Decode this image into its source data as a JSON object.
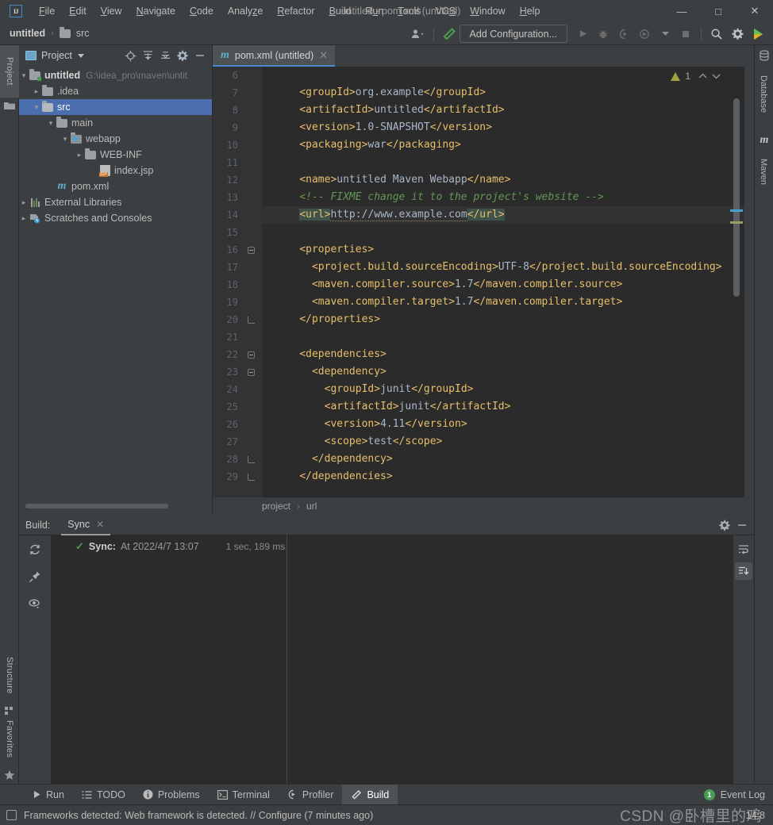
{
  "window": {
    "title": "untitled - pom.xml (untitled)",
    "logo_text": "IJ",
    "minimize": "—",
    "maximize": "□",
    "close": "✕"
  },
  "menu": {
    "items": [
      {
        "label": "File"
      },
      {
        "label": "Edit"
      },
      {
        "label": "View"
      },
      {
        "label": "Navigate"
      },
      {
        "label": "Code"
      },
      {
        "label": "Analyze"
      },
      {
        "label": "Refactor"
      },
      {
        "label": "Build"
      },
      {
        "label": "Run"
      },
      {
        "label": "Tools"
      },
      {
        "label": "VCS"
      },
      {
        "label": "Window"
      },
      {
        "label": "Help"
      }
    ]
  },
  "navbar": {
    "project_name": "untitled",
    "separator": "›",
    "current": "src",
    "add_configuration": "Add Configuration...",
    "icons": [
      "user-avatar-icon",
      "build-hammer-icon",
      "run-icon",
      "debug-icon",
      "run-coverage-icon",
      "profile-icon",
      "stop-icon",
      "search-everywhere-icon",
      "settings-gear-icon",
      "updates-icon"
    ]
  },
  "left_strip": {
    "project_label": "Project",
    "structure_label": "Structure",
    "favorites_label": "Favorites"
  },
  "right_strip": {
    "database_label": "Database",
    "maven_label": "Maven",
    "maven_glyph": "m"
  },
  "project_panel": {
    "title": "Project",
    "header_icons": [
      "locate-icon",
      "expand-all-icon",
      "collapse-all-icon",
      "settings-gear-icon",
      "hide-icon"
    ],
    "tree": [
      {
        "label": "untitled",
        "path": "G:\\idea_pro\\maven\\untit",
        "icon": "module-folder-icon",
        "indent": 0,
        "chevron": "v",
        "bold": true,
        "selected": false
      },
      {
        "label": ".idea",
        "path": "",
        "icon": "folder-icon",
        "indent": 1,
        "chevron": ">",
        "bold": false,
        "selected": false
      },
      {
        "label": "src",
        "path": "",
        "icon": "folder-icon",
        "indent": 1,
        "chevron": "v",
        "bold": false,
        "selected": true
      },
      {
        "label": "main",
        "path": "",
        "icon": "folder-icon",
        "indent": 2,
        "chevron": "v",
        "bold": false,
        "selected": false
      },
      {
        "label": "webapp",
        "path": "",
        "icon": "webapp-folder-icon",
        "indent": 3,
        "chevron": "v",
        "bold": false,
        "selected": false
      },
      {
        "label": "WEB-INF",
        "path": "",
        "icon": "folder-icon",
        "indent": 4,
        "chevron": ">",
        "bold": false,
        "selected": false
      },
      {
        "label": "index.jsp",
        "path": "",
        "icon": "jsp-file-icon",
        "indent": 5,
        "chevron": "",
        "bold": false,
        "selected": false
      },
      {
        "label": "pom.xml",
        "path": "",
        "icon": "maven-file-icon",
        "indent": 2,
        "chevron": "",
        "bold": false,
        "selected": false
      },
      {
        "label": "External Libraries",
        "path": "",
        "icon": "libraries-icon",
        "indent": 0,
        "chevron": ">",
        "bold": false,
        "selected": false
      },
      {
        "label": "Scratches and Consoles",
        "path": "",
        "icon": "scratches-icon",
        "indent": 0,
        "chevron": ">",
        "bold": false,
        "selected": false
      }
    ]
  },
  "editor": {
    "tab": {
      "label": "pom.xml (untitled)",
      "icon": "maven-file-icon",
      "close": "✕"
    },
    "warning_count": "1",
    "warning_icon": "warning-triangle-icon",
    "nav_up": "⌃",
    "nav_down": "⌄",
    "first_line_number": 6,
    "current_line": 14,
    "lines": [
      {
        "n": 6,
        "fold": "",
        "html": ""
      },
      {
        "n": 7,
        "fold": "",
        "html": "    <span class='tg'>&lt;groupId&gt;</span><span class='vl'>org.example</span><span class='tg'>&lt;/groupId&gt;</span>"
      },
      {
        "n": 8,
        "fold": "",
        "html": "    <span class='tg'>&lt;artifactId&gt;</span><span class='vl'>untitled</span><span class='tg'>&lt;/artifactId&gt;</span>"
      },
      {
        "n": 9,
        "fold": "",
        "html": "    <span class='tg'>&lt;version&gt;</span><span class='vl'>1.0-SNAPSHOT</span><span class='tg'>&lt;/version&gt;</span>"
      },
      {
        "n": 10,
        "fold": "",
        "html": "    <span class='tg'>&lt;packaging&gt;</span><span class='vl'>war</span><span class='tg'>&lt;/packaging&gt;</span>"
      },
      {
        "n": 11,
        "fold": "",
        "html": ""
      },
      {
        "n": 12,
        "fold": "",
        "html": "    <span class='tg'>&lt;name&gt;</span><span class='vl'>untitled Maven Webapp</span><span class='tg'>&lt;/name&gt;</span>"
      },
      {
        "n": 13,
        "fold": "",
        "html": "    <span class='cm'>&lt;!-- FIXME change it to the project's website --&gt;</span>"
      },
      {
        "n": 14,
        "fold": "",
        "html": "    <span class='tg hl'>&lt;url&gt;</span><span class='urltext'>http://www.example.com</span><span class='tg hl'>&lt;/url&gt;</span>"
      },
      {
        "n": 15,
        "fold": "",
        "html": ""
      },
      {
        "n": 16,
        "fold": "open",
        "html": "    <span class='tg'>&lt;properties&gt;</span>"
      },
      {
        "n": 17,
        "fold": "",
        "html": "      <span class='tg'>&lt;project.build.sourceEncoding&gt;</span><span class='vl'>UTF-8</span><span class='tg'>&lt;/project.build.sourceEncoding&gt;</span>"
      },
      {
        "n": 18,
        "fold": "",
        "html": "      <span class='tg'>&lt;maven.compiler.source&gt;</span><span class='vl'>1.7</span><span class='tg'>&lt;/maven.compiler.source&gt;</span>"
      },
      {
        "n": 19,
        "fold": "",
        "html": "      <span class='tg'>&lt;maven.compiler.target&gt;</span><span class='vl'>1.7</span><span class='tg'>&lt;/maven.compiler.target&gt;</span>"
      },
      {
        "n": 20,
        "fold": "close",
        "html": "    <span class='tg'>&lt;/properties&gt;</span>"
      },
      {
        "n": 21,
        "fold": "",
        "html": ""
      },
      {
        "n": 22,
        "fold": "open",
        "html": "    <span class='tg'>&lt;dependencies&gt;</span>"
      },
      {
        "n": 23,
        "fold": "open",
        "html": "      <span class='tg'>&lt;dependency&gt;</span>"
      },
      {
        "n": 24,
        "fold": "",
        "html": "        <span class='tg'>&lt;groupId&gt;</span><span class='vl'>junit</span><span class='tg'>&lt;/groupId&gt;</span>"
      },
      {
        "n": 25,
        "fold": "",
        "html": "        <span class='tg'>&lt;artifactId&gt;</span><span class='vl'>junit</span><span class='tg'>&lt;/artifactId&gt;</span>"
      },
      {
        "n": 26,
        "fold": "",
        "html": "        <span class='tg'>&lt;version&gt;</span><span class='vl'>4.11</span><span class='tg'>&lt;/version&gt;</span>"
      },
      {
        "n": 27,
        "fold": "",
        "html": "        <span class='tg'>&lt;scope&gt;</span><span class='vl'>test</span><span class='tg'>&lt;/scope&gt;</span>"
      },
      {
        "n": 28,
        "fold": "close",
        "html": "      <span class='tg'>&lt;/dependency&gt;</span>"
      },
      {
        "n": 29,
        "fold": "close",
        "html": "    <span class='tg'>&lt;/dependencies&gt;</span>"
      }
    ],
    "breadcrumb": [
      "project",
      "url"
    ],
    "breadcrumb_separator": "›"
  },
  "build_window": {
    "label": "Build:",
    "tab_label": "Sync",
    "tab_close": "✕",
    "left_icons": [
      "refresh-icon",
      "pin-icon",
      "eye-filter-icon"
    ],
    "right_icons": [
      "settings-gear-icon",
      "hide-icon"
    ],
    "detail_icons": [
      "soft-wrap-icon",
      "scroll-to-end-icon"
    ],
    "sync_entry": {
      "status_icon": "checkmark-icon",
      "name": "Sync:",
      "at": "At 2022/4/7 13:07",
      "duration": "1 sec, 189 ms"
    }
  },
  "bottom_bar": {
    "buttons": [
      {
        "label": "Run",
        "icon": "run-icon",
        "active": false
      },
      {
        "label": "TODO",
        "icon": "todo-list-icon",
        "active": false
      },
      {
        "label": "Problems",
        "icon": "problems-icon",
        "active": false
      },
      {
        "label": "Terminal",
        "icon": "terminal-icon",
        "active": false
      },
      {
        "label": "Profiler",
        "icon": "profiler-icon",
        "active": false
      },
      {
        "label": "Build",
        "icon": "build-hammer-icon",
        "active": true
      }
    ],
    "event_log": {
      "label": "Event Log",
      "count": "1"
    }
  },
  "status_bar": {
    "icon": "notification-icon",
    "message": "Frameworks detected: Web framework is detected. // Configure (7 minutes ago)",
    "caret_position": "14:8",
    "watermark": "CSDN @卧槽里的鸡"
  },
  "colors": {
    "accent_blue": "#4b6eaf",
    "editor_bg": "#2b2b2b",
    "panel_bg": "#3c3f41",
    "gutter_bg": "#313335",
    "tag_orange": "#e8bf6a",
    "value_gray": "#a9b7c6",
    "comment_green": "#629755",
    "success_green": "#499c54",
    "warning_yellow": "#a5a13a"
  }
}
